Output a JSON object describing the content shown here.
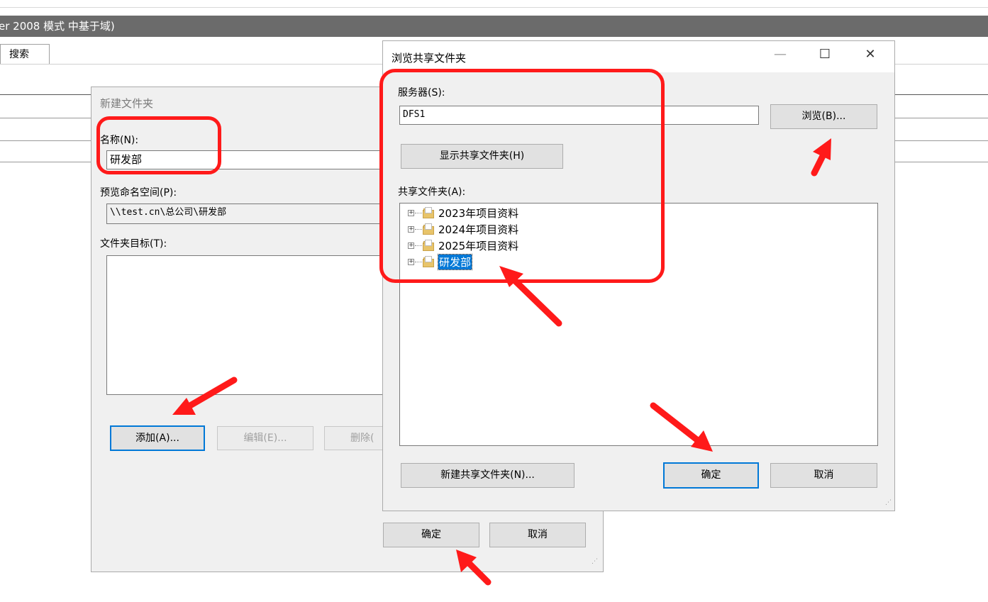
{
  "background": {
    "title": "er 2008 模式 中基于域)",
    "tab_label": "搜索"
  },
  "new_folder_dialog": {
    "title": "新建文件夹",
    "name_label": "名称(N):",
    "name_value": "研发部",
    "preview_label": "预览命名空间(P):",
    "preview_value": "\\\\test.cn\\总公司\\研发部",
    "targets_label": "文件夹目标(T):",
    "add_button": "添加(A)...",
    "edit_button": "编辑(E)...",
    "delete_button": "删除(",
    "ok_button": "确定",
    "cancel_button": "取消"
  },
  "browse_dialog": {
    "title": "浏览共享文件夹",
    "minimize": "—",
    "maximize": "☐",
    "close": "✕",
    "server_label": "服务器(S):",
    "server_value": "DFS1",
    "browse_button": "浏览(B)...",
    "show_shares_button": "显示共享文件夹(H)",
    "shares_label": "共享文件夹(A):",
    "shares": [
      {
        "label": "2023年项目资料",
        "selected": false
      },
      {
        "label": "2024年项目资料",
        "selected": false
      },
      {
        "label": "2025年项目资料",
        "selected": false
      },
      {
        "label": "研发部",
        "selected": true
      }
    ],
    "new_share_button": "新建共享文件夹(N)...",
    "ok_button": "确定",
    "cancel_button": "取消"
  },
  "colors": {
    "annotation_red": "#ff1a1a",
    "focus_blue": "#0078d7",
    "dialog_bg": "#f0f0f0"
  }
}
